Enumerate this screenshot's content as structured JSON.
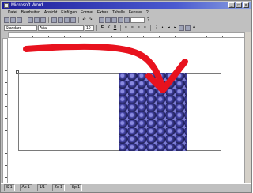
{
  "window": {
    "title": "Microsoft Word"
  },
  "menu": [
    "Datei",
    "Bearbeiten",
    "Ansicht",
    "Einfügen",
    "Format",
    "Extras",
    "Tabelle",
    "Fenster",
    "?"
  ],
  "toolbar": {
    "style_value": "Standard",
    "font_value": "Arial",
    "size_value": "10"
  },
  "status": {
    "page": "S 1",
    "section": "Ab 1",
    "position": "1/1",
    "line": "Ze 1",
    "column": "Sp 1"
  },
  "colors": {
    "annotation_arrow": "#e8121e",
    "tile_fill": "#2c2c74",
    "title_bar": "#1e1e9a"
  }
}
